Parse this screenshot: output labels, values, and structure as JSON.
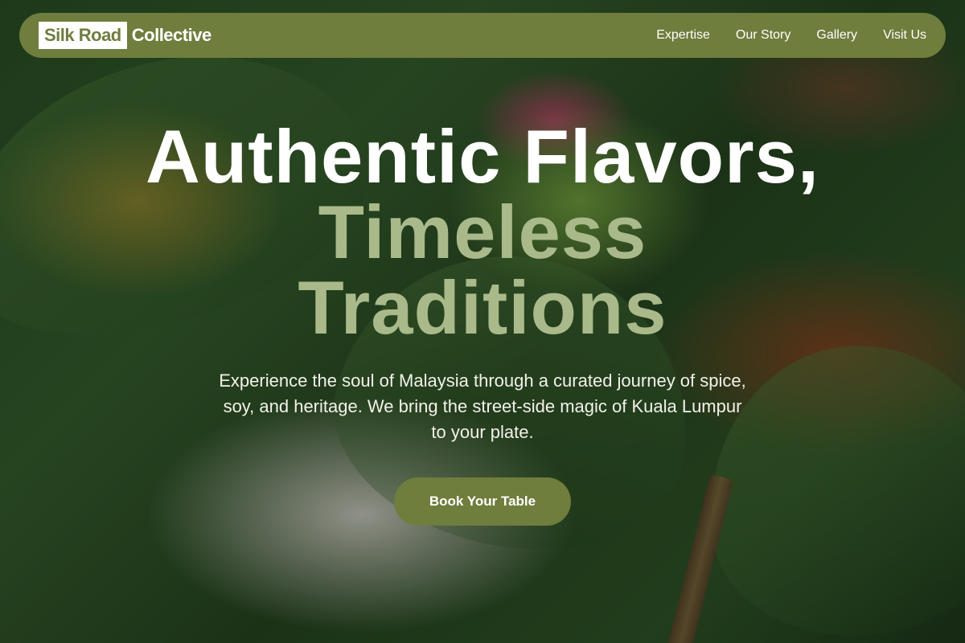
{
  "nav": {
    "brand_highlight": "Silk Road",
    "brand_rest": "Collective",
    "links": [
      "Expertise",
      "Our Story",
      "Gallery",
      "Visit Us"
    ]
  },
  "hero": {
    "title_line1": "Authentic Flavors,",
    "title_line2": "Timeless",
    "title_line3": "Traditions",
    "subtitle": "Experience the soul of Malaysia through a curated journey of spice, soy, and heritage. We bring the street-side magic of Kuala Lumpur to your plate.",
    "cta_label": "Book Your Table"
  },
  "colors": {
    "brand_olive": "#6f7d3d",
    "accent_sage": "#a9b98a",
    "text_white": "#ffffff"
  }
}
